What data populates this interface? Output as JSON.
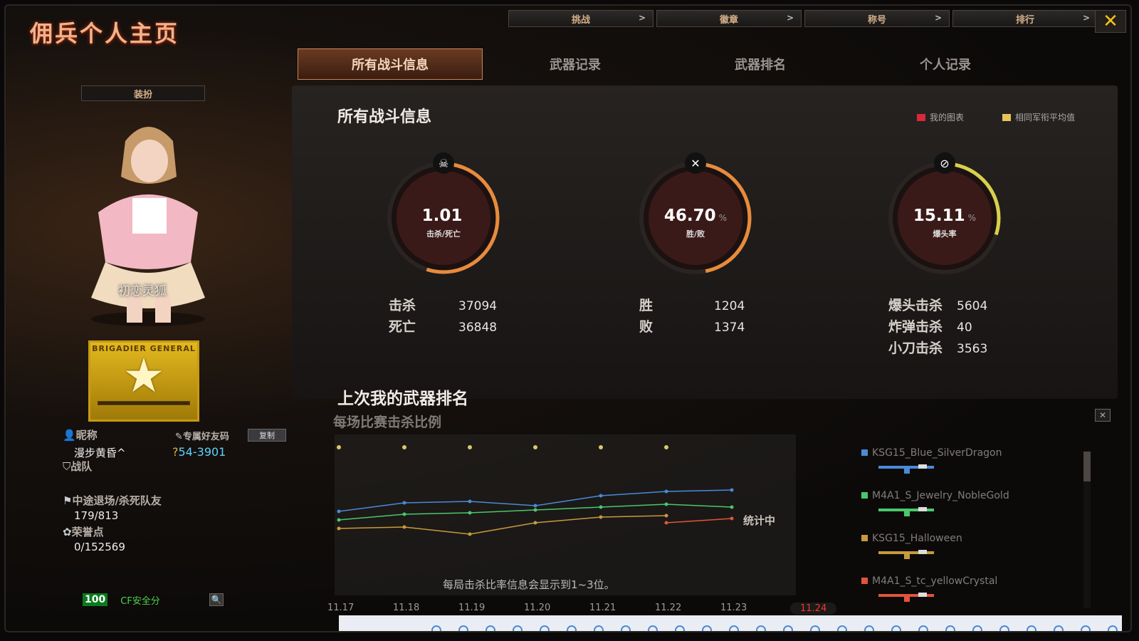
{
  "title": "佣兵个人主页",
  "top_nav": [
    {
      "label": "挑战",
      "arrow": ">"
    },
    {
      "label": "徽章",
      "arrow": ">"
    },
    {
      "label": "称号",
      "arrow": ">"
    },
    {
      "label": "排行",
      "arrow": ">"
    }
  ],
  "close_label": "✕",
  "tabs": [
    {
      "label": "所有战斗信息",
      "active": true
    },
    {
      "label": "武器记录",
      "active": false
    },
    {
      "label": "武器排名",
      "active": false
    },
    {
      "label": "个人记录",
      "active": false
    }
  ],
  "left": {
    "dress_button": "装扮",
    "character_name": "初恋灵狐",
    "rank_title": "BRIGADIER GENERAL",
    "nickname_label": "昵称",
    "nickname": "漫步黄昏^",
    "friend_code_label": "专属好友码",
    "friend_code": "54-3901",
    "copy_button": "复制",
    "clan_label": "战队",
    "quit_label": "中途退场/杀死队友",
    "quit_value": "179/813",
    "honor_label": "荣誉点",
    "honor_value": "0/152569",
    "security_score": "100",
    "security_label": "CF安全分"
  },
  "panel": {
    "title": "所有战斗信息",
    "legend_mine": "我的图表",
    "legend_avg": "相同军衔平均值",
    "legend_colors": [
      "#d9283b",
      "#e8c35a"
    ]
  },
  "gauges": [
    {
      "value": "1.01",
      "unit": "",
      "label": "击杀/死亡",
      "icon": "skull-icon",
      "fill": 0.55
    },
    {
      "value": "46.70",
      "unit": "%",
      "label": "胜/败",
      "icon": "crossed-guns-icon",
      "fill": 0.47
    },
    {
      "value": "15.11",
      "unit": "%",
      "label": "爆头率",
      "icon": "headshot-icon",
      "fill": 0.3
    }
  ],
  "stats": {
    "kills_label": "击杀",
    "kills": "37094",
    "deaths_label": "死亡",
    "deaths": "36848",
    "wins_label": "胜",
    "wins": "1204",
    "losses_label": "败",
    "losses": "1374",
    "headshot_label": "爆头击杀",
    "headshot": "5604",
    "bomb_label": "炸弹击杀",
    "bomb": "40",
    "knife_label": "小刀击杀",
    "knife": "3563"
  },
  "weapon_rank": {
    "title": "上次我的武器排名",
    "subtitle": "每场比赛击杀比例",
    "counting": "统计中",
    "note": "每局击杀比率信息会显示到1~3位。"
  },
  "chart_data": {
    "type": "line",
    "x": [
      "11.17",
      "11.18",
      "11.19",
      "11.20",
      "11.21",
      "11.22",
      "11.23",
      "11.24"
    ],
    "active_x": "11.24",
    "ylim": [
      0,
      1
    ],
    "series": [
      {
        "name": "KSG15_Blue_SilverDragon",
        "color": "#4a8ad8",
        "values": [
          0.55,
          0.61,
          0.62,
          0.59,
          0.66,
          0.69,
          0.7,
          null
        ]
      },
      {
        "name": "M4A1_S_Jewelry_NobleGold",
        "color": "#49c86a",
        "values": [
          0.49,
          0.53,
          0.54,
          0.56,
          0.58,
          0.6,
          0.58,
          null
        ]
      },
      {
        "name": "KSG15_Halloween",
        "color": "#c89a3b",
        "values": [
          0.43,
          0.44,
          0.39,
          0.47,
          0.51,
          0.52,
          null,
          null
        ]
      },
      {
        "name": "M4A1_S_tc_yellowCrystal",
        "color": "#e0553b",
        "values": [
          null,
          null,
          null,
          null,
          null,
          0.47,
          0.5,
          null
        ]
      }
    ]
  }
}
